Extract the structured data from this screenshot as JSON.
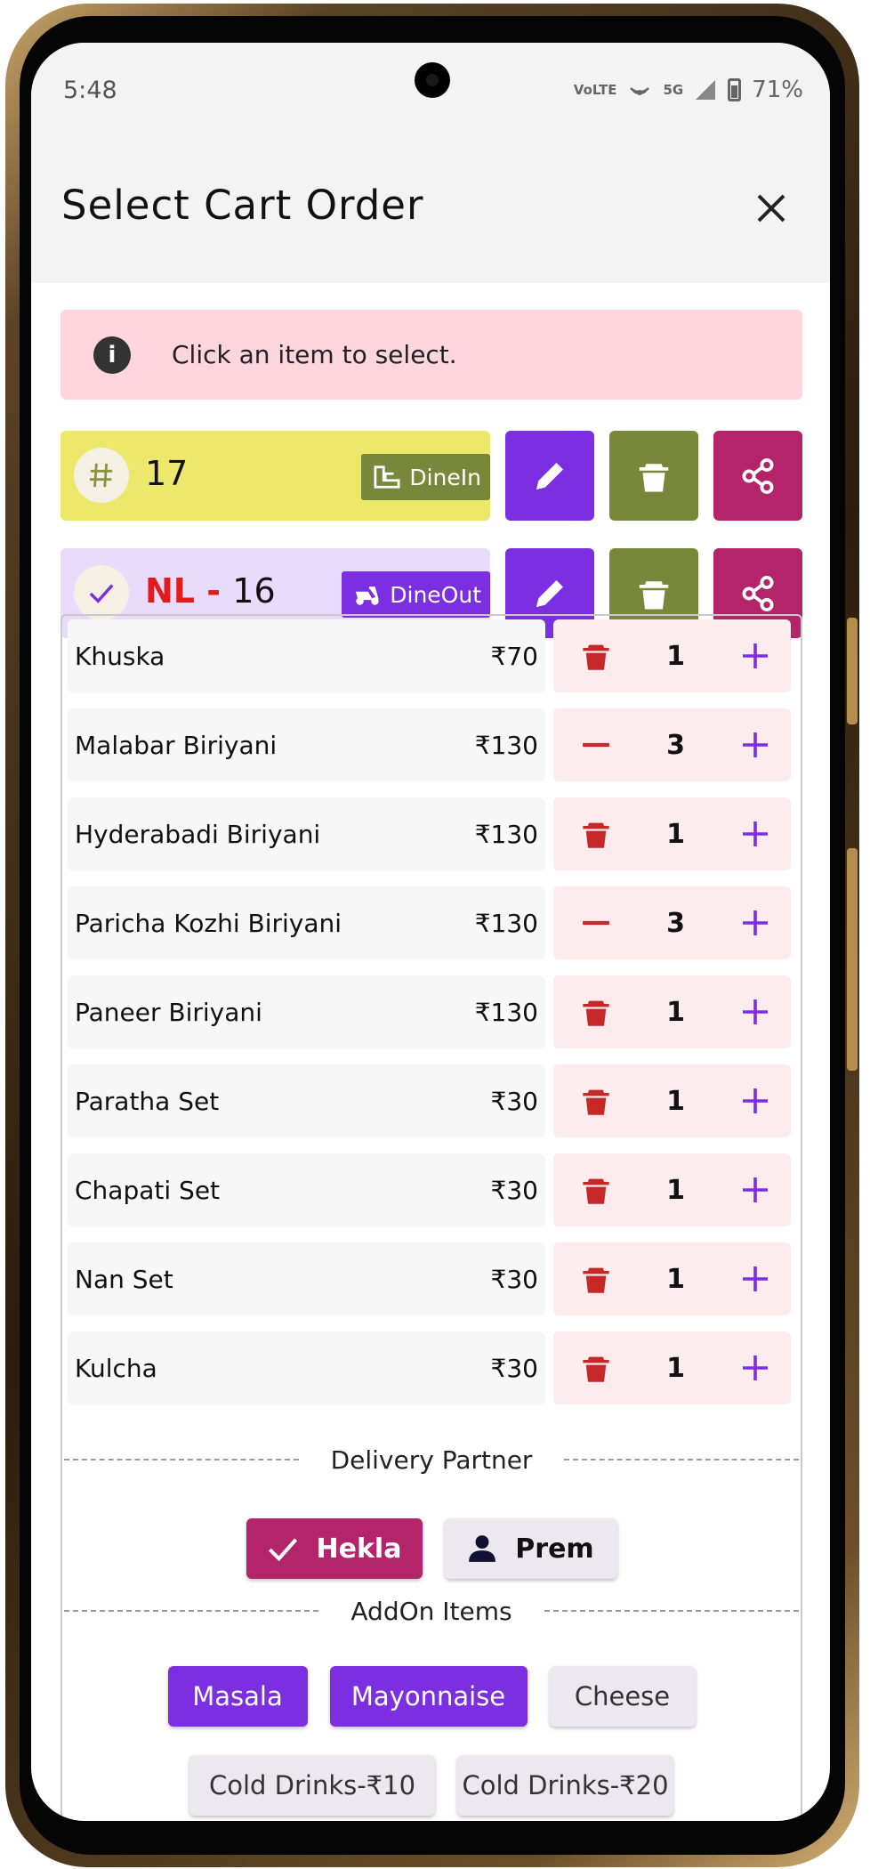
{
  "status_bar": {
    "time": "5:48",
    "net1": "VoLTE",
    "net2": "5G",
    "battery": "71%"
  },
  "header": {
    "title": "Select Cart Order"
  },
  "info": {
    "text": "Click an item to select."
  },
  "orders": [
    {
      "prefix": "",
      "separator": "",
      "number": "17",
      "type": "DineIn",
      "card_color": "#ede86c",
      "type_color": "#77883a"
    },
    {
      "prefix": "NL",
      "separator": " - ",
      "number": "16",
      "type": "DineOut",
      "card_color": "#e8dbfb",
      "type_color": "#7c2fe0"
    }
  ],
  "colors": {
    "edit": "#7c2fe0",
    "delete": "#77883a",
    "share": "#b3246b",
    "trash": "#c62828",
    "accent": "#7c2fe0",
    "partner": "#b3246b"
  },
  "items": [
    {
      "name": "Khuska",
      "price": "₹70",
      "qty": "1",
      "left_icon": "trash"
    },
    {
      "name": "Malabar Biriyani",
      "price": "₹130",
      "qty": "3",
      "left_icon": "minus"
    },
    {
      "name": "Hyderabadi Biriyani",
      "price": "₹130",
      "qty": "1",
      "left_icon": "trash"
    },
    {
      "name": "Paricha Kozhi Biriyani",
      "price": "₹130",
      "qty": "3",
      "left_icon": "minus"
    },
    {
      "name": "Paneer Biriyani",
      "price": "₹130",
      "qty": "1",
      "left_icon": "trash"
    },
    {
      "name": "Paratha Set",
      "price": "₹30",
      "qty": "1",
      "left_icon": "trash"
    },
    {
      "name": "Chapati Set",
      "price": "₹30",
      "qty": "1",
      "left_icon": "trash"
    },
    {
      "name": "Nan Set",
      "price": "₹30",
      "qty": "1",
      "left_icon": "trash"
    },
    {
      "name": "Kulcha",
      "price": "₹30",
      "qty": "1",
      "left_icon": "trash"
    }
  ],
  "delivery": {
    "label": "Delivery Partner",
    "partners": [
      {
        "name": "Hekla",
        "selected": true
      },
      {
        "name": "Prem",
        "selected": false
      }
    ]
  },
  "addons": {
    "label": "AddOn Items",
    "row1": [
      {
        "name": "Masala",
        "selected": true
      },
      {
        "name": "Mayonnaise",
        "selected": true
      },
      {
        "name": "Cheese",
        "selected": false
      }
    ],
    "row2": [
      {
        "name": "Cold Drinks-₹10",
        "selected": false
      },
      {
        "name": "Cold Drinks-₹20",
        "selected": false
      }
    ]
  }
}
